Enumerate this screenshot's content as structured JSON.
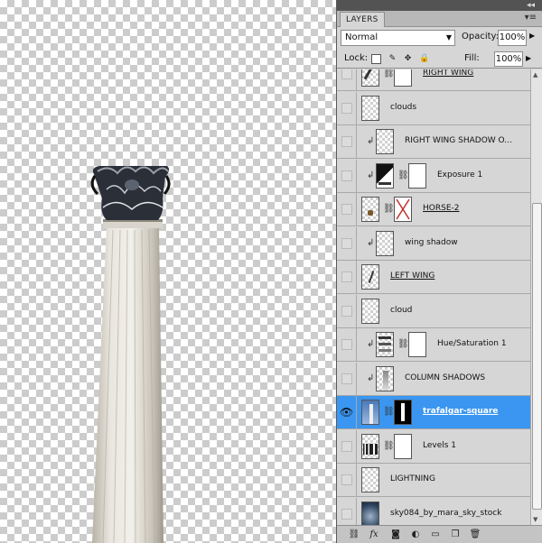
{
  "panel": {
    "tab_label": "LAYERS",
    "blend_mode": "Normal",
    "opacity_label": "Opacity:",
    "opacity_value": "100%",
    "lock_label": "Lock:",
    "fill_label": "Fill:",
    "fill_value": "100%"
  },
  "layers": [
    {
      "name": "RIGHT WING",
      "visible": false,
      "clipped": false,
      "has_mask": true,
      "underlined": true,
      "selected": false,
      "thumb": "brush",
      "partial": true
    },
    {
      "name": "clouds",
      "visible": false,
      "clipped": false,
      "has_mask": false,
      "underlined": false,
      "selected": false,
      "thumb": "empty"
    },
    {
      "name": "RIGHT WING SHADOW O...",
      "visible": false,
      "clipped": true,
      "has_mask": false,
      "underlined": false,
      "selected": false,
      "thumb": "empty"
    },
    {
      "name": "Exposure 1",
      "visible": false,
      "clipped": true,
      "has_mask": true,
      "underlined": false,
      "selected": false,
      "thumb": "exposure"
    },
    {
      "name": "HORSE-2",
      "visible": false,
      "clipped": false,
      "has_mask": true,
      "underlined": true,
      "selected": false,
      "thumb": "horse"
    },
    {
      "name": "wing shadow",
      "visible": false,
      "clipped": true,
      "has_mask": false,
      "underlined": false,
      "selected": false,
      "thumb": "empty"
    },
    {
      "name": "LEFT WING",
      "visible": false,
      "clipped": false,
      "has_mask": false,
      "underlined": true,
      "selected": false,
      "thumb": "stroke"
    },
    {
      "name": "cloud",
      "visible": false,
      "clipped": false,
      "has_mask": false,
      "underlined": false,
      "selected": false,
      "thumb": "empty"
    },
    {
      "name": "Hue/Saturation 1",
      "visible": false,
      "clipped": true,
      "has_mask": true,
      "underlined": false,
      "selected": false,
      "thumb": "hue"
    },
    {
      "name": "COLUMN SHADOWS",
      "visible": false,
      "clipped": true,
      "has_mask": false,
      "underlined": false,
      "selected": false,
      "thumb": "shadow"
    },
    {
      "name": "trafalgar-square",
      "visible": true,
      "clipped": false,
      "has_mask": true,
      "underlined": true,
      "selected": true,
      "thumb": "photo"
    },
    {
      "name": "Levels 1",
      "visible": false,
      "clipped": false,
      "has_mask": true,
      "underlined": false,
      "selected": false,
      "thumb": "levels"
    },
    {
      "name": "LIGHTNING",
      "visible": false,
      "clipped": false,
      "has_mask": false,
      "underlined": false,
      "selected": false,
      "thumb": "empty"
    },
    {
      "name": "sky084_by_mara_sky_stock",
      "visible": false,
      "clipped": false,
      "has_mask": false,
      "underlined": false,
      "selected": false,
      "thumb": "sky"
    }
  ],
  "icons": {
    "collapse": "double-chevron-icon",
    "panel_menu": "panel-menu-icon",
    "footer": [
      "link-layers-icon",
      "fx-icon",
      "add-mask-icon",
      "adjustment-layer-icon",
      "group-folder-icon",
      "new-layer-icon",
      "trash-icon"
    ]
  }
}
